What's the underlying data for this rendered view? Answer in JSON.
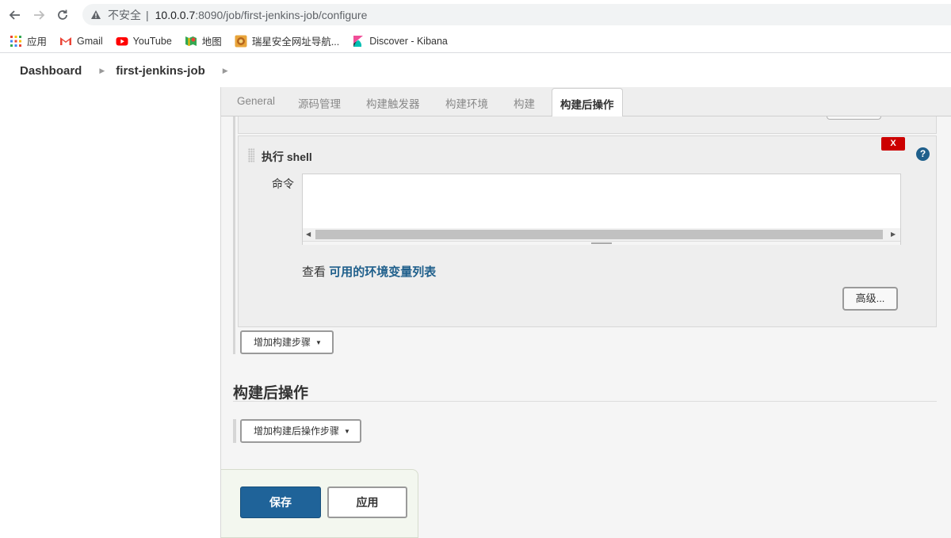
{
  "browser": {
    "security_label": "不安全",
    "url_host": "10.0.0.7",
    "url_rest": ":8090/job/first-jenkins-job/configure",
    "bookmarks": [
      {
        "label": "应用",
        "icon": "apps-grid-icon"
      },
      {
        "label": "Gmail",
        "icon": "gmail-icon"
      },
      {
        "label": "YouTube",
        "icon": "youtube-icon"
      },
      {
        "label": "地图",
        "icon": "maps-icon"
      },
      {
        "label": "瑞星安全网址导航...",
        "icon": "rising-lion-icon"
      },
      {
        "label": "Discover - Kibana",
        "icon": "kibana-icon"
      }
    ]
  },
  "breadcrumbs": {
    "dashboard": "Dashboard",
    "job": "first-jenkins-job"
  },
  "tabs": [
    {
      "label": "General",
      "active": false
    },
    {
      "label": "源码管理",
      "active": false
    },
    {
      "label": "构建触发器",
      "active": false
    },
    {
      "label": "构建环境",
      "active": false
    },
    {
      "label": "构建",
      "active": false
    },
    {
      "label": "构建后操作",
      "active": true
    }
  ],
  "build_step": {
    "title": "执行 shell",
    "delete_label": "X",
    "command_label": "命令",
    "command_value": "",
    "env_prefix": "查看",
    "env_link": "可用的环境变量列表",
    "advanced_label": "高级...",
    "help_label": "?"
  },
  "add_build_step": "增加构建步骤",
  "post_build": {
    "title": "构建后操作",
    "add_label": "增加构建后操作步骤"
  },
  "actions": {
    "save": "保存",
    "apply": "应用"
  },
  "colors": {
    "primary": "#1f6399",
    "link": "#1f5f8b",
    "danger": "#cc0000"
  }
}
